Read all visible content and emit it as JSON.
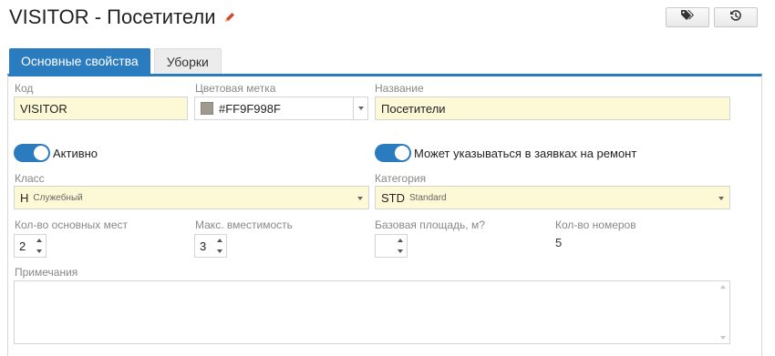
{
  "header": {
    "title": "VISITOR - Посетители",
    "edit_icon": "pencil-icon",
    "accent_color": "#2b7bbf"
  },
  "toolbar": {
    "tags_icon": "tags-icon",
    "history_icon": "history-icon"
  },
  "tabs": [
    {
      "label": "Основные свойства",
      "active": true
    },
    {
      "label": "Уборки",
      "active": false
    }
  ],
  "form": {
    "code": {
      "label": "Код",
      "value": "VISITOR"
    },
    "color": {
      "label": "Цветовая метка",
      "value": "#FF9F998F",
      "swatch": "#9f998f"
    },
    "name": {
      "label": "Название",
      "value": "Посетители"
    },
    "active": {
      "label": "Активно",
      "on": true
    },
    "repair": {
      "label": "Может указываться в заявках на ремонт",
      "on": true
    },
    "class": {
      "label": "Класс",
      "code": "Н",
      "desc": "Служебный"
    },
    "category": {
      "label": "Категория",
      "code": "STD",
      "desc": "Standard"
    },
    "main_places": {
      "label": "Кол-во основных мест",
      "value": "2"
    },
    "max_capacity": {
      "label": "Макс. вместимость",
      "value": "3"
    },
    "base_area": {
      "label": "Базовая площадь, м?",
      "value": ""
    },
    "rooms_count": {
      "label": "Кол-во номеров",
      "value": "5"
    },
    "notes": {
      "label": "Примечания",
      "value": ""
    }
  }
}
